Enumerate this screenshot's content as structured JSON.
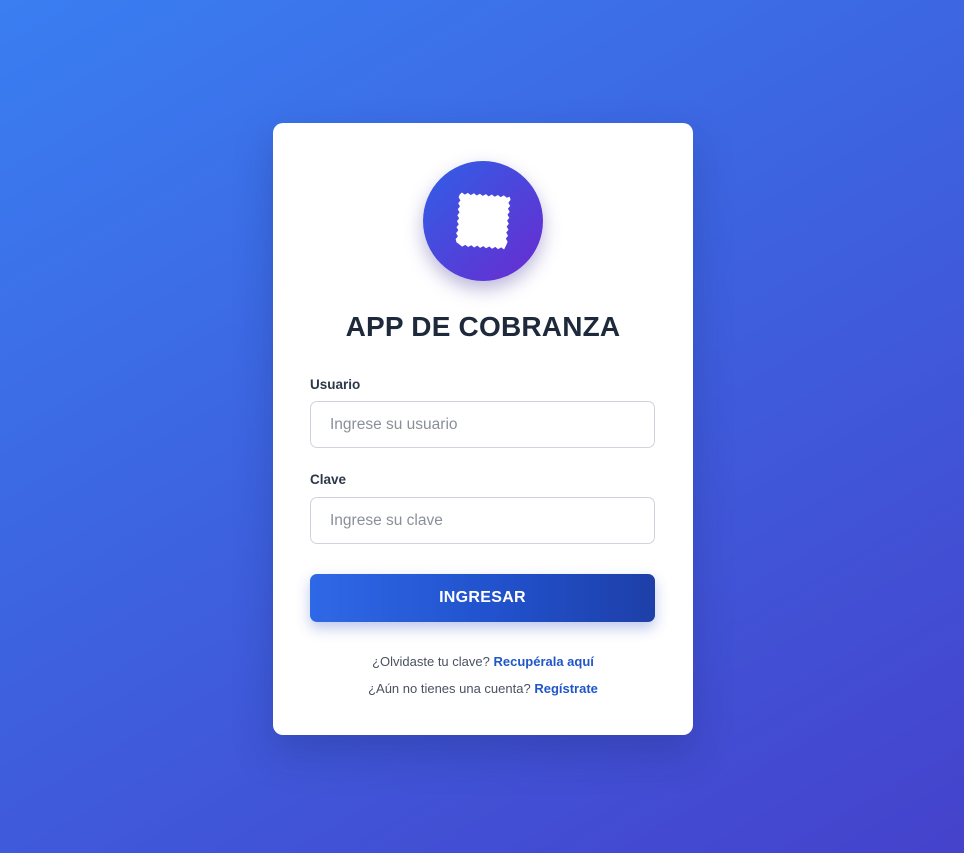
{
  "app": {
    "title": "APP DE COBRANZA",
    "logo_icon": "receipt-icon"
  },
  "form": {
    "username_label": "Usuario",
    "username_placeholder": "Ingrese su usuario",
    "username_value": "",
    "password_label": "Clave",
    "password_placeholder": "Ingrese su clave",
    "password_value": "",
    "submit_label": "INGRESAR"
  },
  "links": {
    "forgot_text": "¿Olvidaste tu clave?",
    "forgot_link": "Recupérala aquí",
    "register_text": "¿Aún no tienes una cuenta?",
    "register_link": "Regístrate"
  },
  "colors": {
    "background_start": "#3a7ef2",
    "background_end": "#4542cc",
    "button": "#2151cc",
    "link": "#2156c9",
    "title": "#1e2a3b"
  }
}
